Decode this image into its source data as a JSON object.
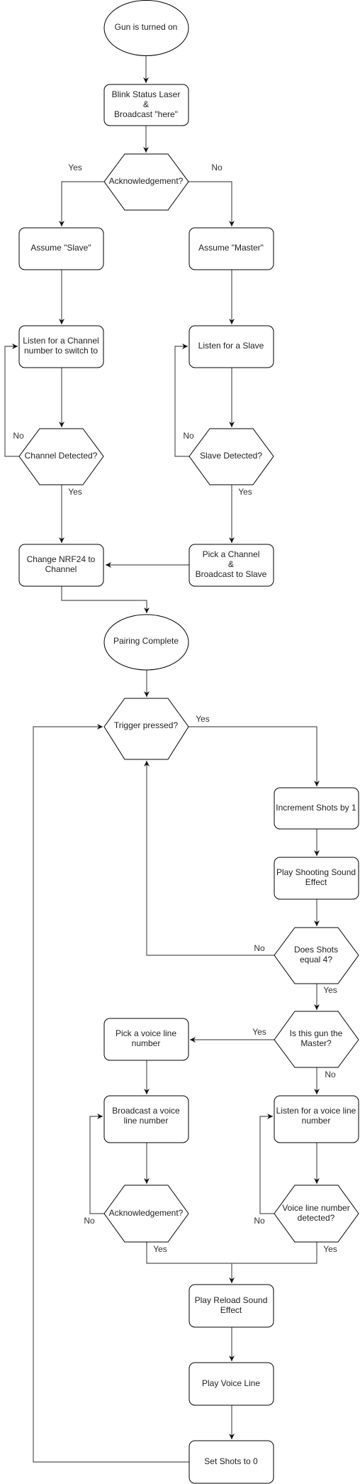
{
  "nodes": {
    "start": [
      "Gun is turned on"
    ],
    "blink": [
      "Blink Status Laser",
      "&",
      "Broadcast \"here\""
    ],
    "ack1": [
      "Acknowledgement?"
    ],
    "assume_slave": [
      "Assume \"Slave\""
    ],
    "assume_master": [
      "Assume \"Master\""
    ],
    "listen_channel": [
      "Listen for a Channel",
      "number to switch to"
    ],
    "listen_slave": [
      "Listen for a Slave"
    ],
    "channel_detected": [
      "Channel Detected?"
    ],
    "slave_detected": [
      "Slave Detected?"
    ],
    "change_nrf": [
      "Change NRF24 to",
      "Channel"
    ],
    "pick_channel": [
      "Pick a Channel",
      "&",
      "Broadcast to Slave"
    ],
    "pairing": [
      "Pairing Complete"
    ],
    "trigger": [
      "Trigger pressed?"
    ],
    "increment": [
      "Increment Shots by 1"
    ],
    "shoot_sfx": [
      "Play Shooting Sound",
      "Effect"
    ],
    "shots4": [
      "Does Shots",
      "equal 4?"
    ],
    "is_master": [
      "Is this gun the",
      "Master?"
    ],
    "pick_voice": [
      "Pick a voice line",
      "number"
    ],
    "broadcast_voice": [
      "Broadcast a voice",
      "line number"
    ],
    "listen_voice": [
      "Listen for a voice line",
      "number"
    ],
    "ack2": [
      "Acknowledgement?"
    ],
    "voice_detected": [
      "Voice line number",
      "detected?"
    ],
    "reload_sfx": [
      "Play Reload Sound",
      "Effect"
    ],
    "play_voice": [
      "Play Voice Line"
    ],
    "set_shots": [
      "Set Shots to 0"
    ]
  },
  "edge_labels": {
    "yes": "Yes",
    "no": "No"
  }
}
